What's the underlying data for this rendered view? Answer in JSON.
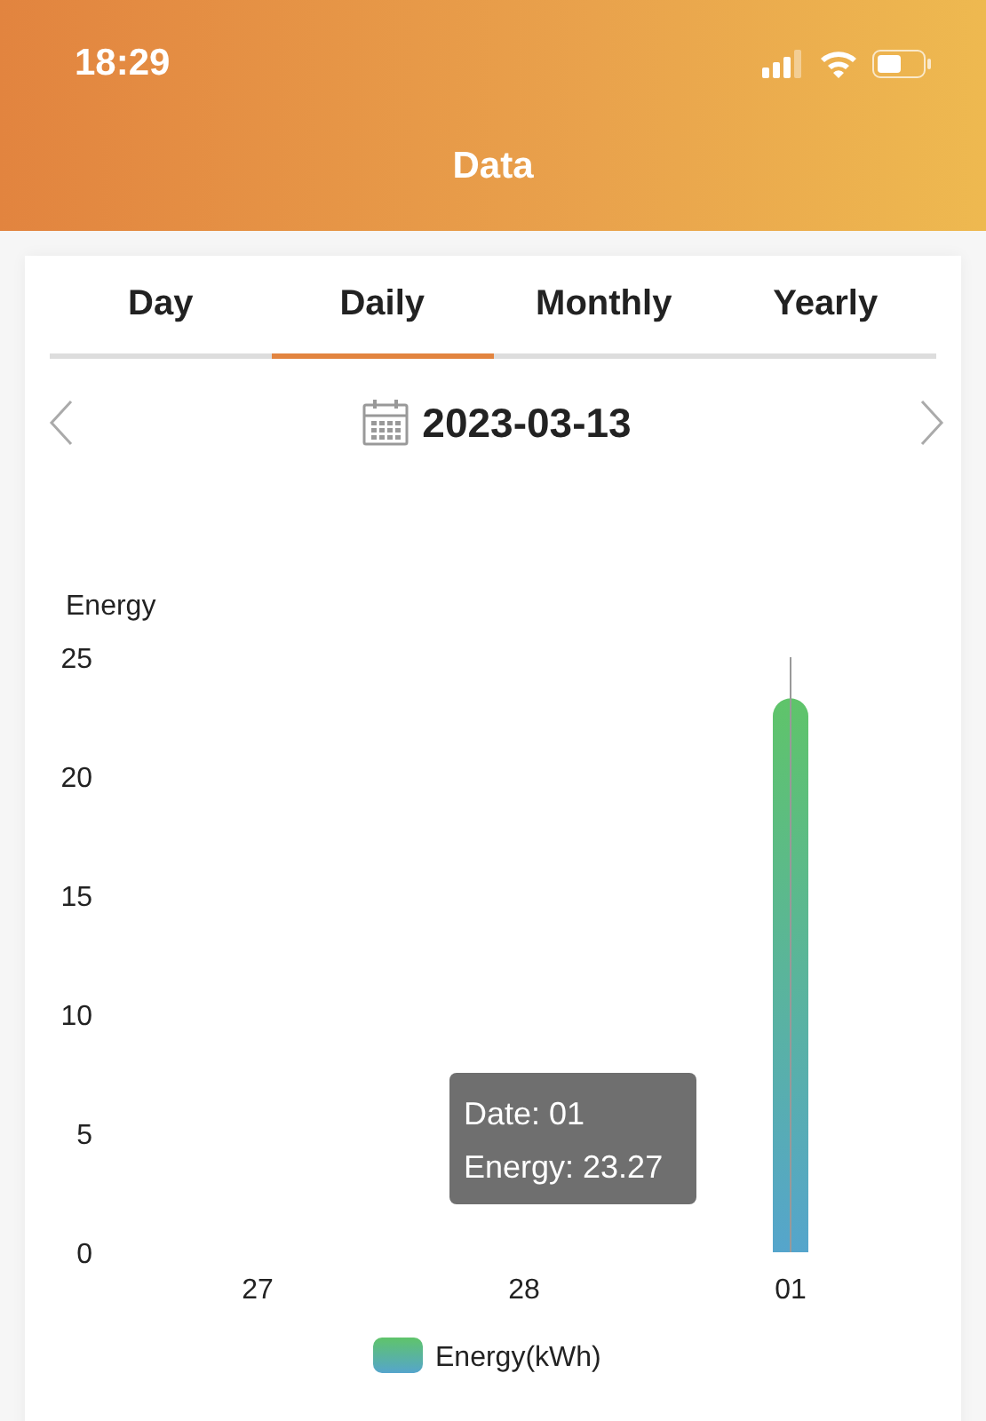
{
  "status_bar": {
    "time": "18:29"
  },
  "header": {
    "title": "Data"
  },
  "tabs": [
    {
      "label": "Day",
      "selected": false
    },
    {
      "label": "Daily",
      "selected": true
    },
    {
      "label": "Monthly",
      "selected": false
    },
    {
      "label": "Yearly",
      "selected": false
    }
  ],
  "date_picker": {
    "date": "2023-03-13"
  },
  "chart": {
    "chart_data": {
      "type": "bar",
      "ylabel": "Energy",
      "categories": [
        "27",
        "28",
        "01"
      ],
      "series": [
        {
          "name": "Energy(kWh)",
          "color": "#5fc46a",
          "values": [
            0,
            0,
            23.27
          ]
        }
      ],
      "ylim": [
        0,
        25
      ],
      "yticks": [
        0,
        5,
        10,
        15,
        20,
        25
      ]
    },
    "tooltip": {
      "lines": [
        "Date: 01",
        "Energy: 23.27"
      ]
    }
  }
}
